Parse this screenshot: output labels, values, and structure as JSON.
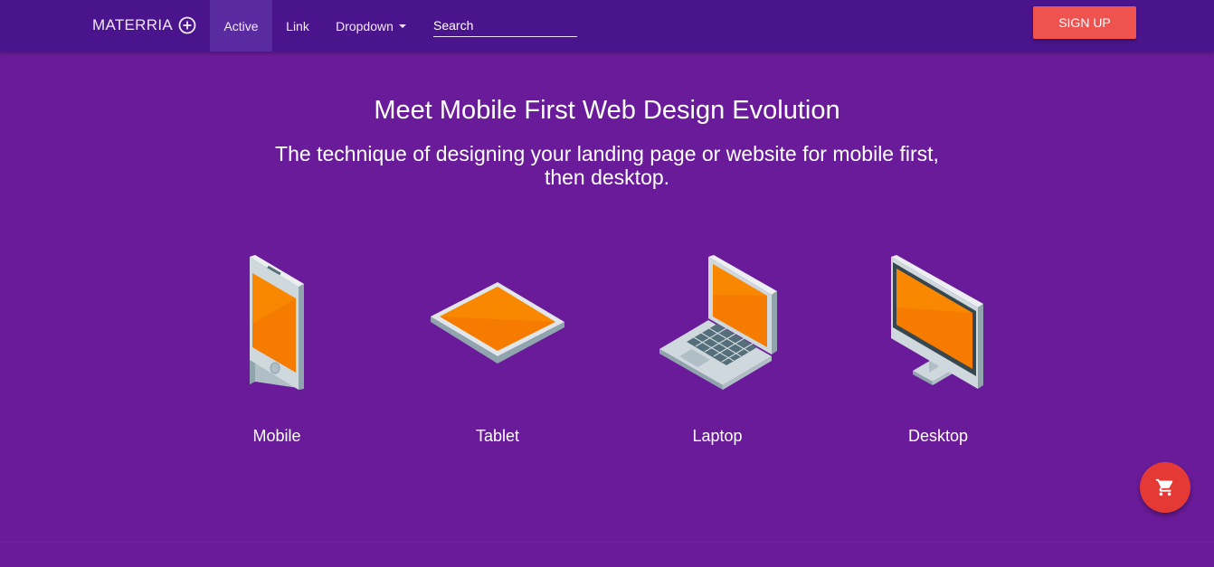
{
  "navbar": {
    "brand": "MATERRIA",
    "brand_icon": "circle-plus-icon",
    "items": [
      {
        "label": "Active",
        "active": true
      },
      {
        "label": "Link"
      },
      {
        "label": "Dropdown",
        "icon": "caret-down-icon"
      }
    ],
    "search_placeholder": "Search",
    "signup_label": "SIGN UP"
  },
  "hero": {
    "title": "Meet Mobile First Web Design Evolution",
    "subtitle": "The technique of designing your landing page or website for mobile first, then desktop."
  },
  "devices": [
    {
      "label": "Mobile",
      "icon": "mobile-phone-icon"
    },
    {
      "label": "Tablet",
      "icon": "tablet-icon"
    },
    {
      "label": "Laptop",
      "icon": "laptop-icon"
    },
    {
      "label": "Desktop",
      "icon": "desktop-monitor-icon"
    }
  ],
  "fab": {
    "icon": "shopping-cart-icon"
  },
  "colors": {
    "background": "#6a1b9a",
    "navbar": "#4a148c",
    "accent": "#ef5350",
    "screen": "#f57c00",
    "device_body": "#cfd8dc"
  }
}
